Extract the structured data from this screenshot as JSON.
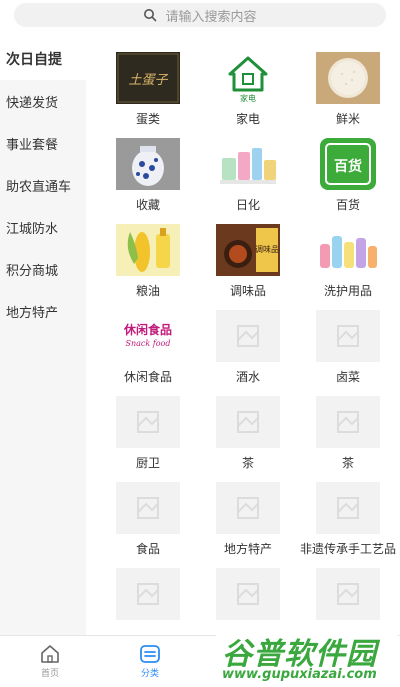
{
  "search": {
    "placeholder": "请输入搜索内容"
  },
  "sidebar": {
    "items": [
      {
        "label": "次日自提",
        "active": true
      },
      {
        "label": "快递发货"
      },
      {
        "label": "事业套餐"
      },
      {
        "label": "助农直通车"
      },
      {
        "label": "江城防水"
      },
      {
        "label": "积分商城"
      },
      {
        "label": "地方特产"
      }
    ]
  },
  "categories": [
    {
      "label": "蛋类",
      "icon": "egg-brand-image"
    },
    {
      "label": "家电",
      "icon": "appliance-house-icon"
    },
    {
      "label": "鲜米",
      "icon": "rice-image"
    },
    {
      "label": "收藏",
      "icon": "porcelain-vase-image"
    },
    {
      "label": "日化",
      "icon": "cosmetics-image"
    },
    {
      "label": "百货",
      "icon": "general-goods-logo"
    },
    {
      "label": "粮油",
      "icon": "corn-oil-image"
    },
    {
      "label": "调味品",
      "icon": "seasoning-image"
    },
    {
      "label": "洗护用品",
      "icon": "toiletries-image"
    },
    {
      "label": "休闲食品",
      "icon": "snack-food-logo"
    },
    {
      "label": "酒水",
      "icon": "placeholder-image"
    },
    {
      "label": "卤菜",
      "icon": "placeholder-image"
    },
    {
      "label": "厨卫",
      "icon": "placeholder-image"
    },
    {
      "label": "茶",
      "icon": "placeholder-image"
    },
    {
      "label": "茶",
      "icon": "placeholder-image"
    },
    {
      "label": "食品",
      "icon": "placeholder-image"
    },
    {
      "label": "地方特产",
      "icon": "placeholder-image"
    },
    {
      "label": "非遗传承手工艺品",
      "icon": "placeholder-image"
    }
  ],
  "logo_texts": {
    "egg": "土蛋子",
    "appliance": "家电",
    "general": "百货",
    "seasoning": "调味品",
    "snack": "休闲食品",
    "snack_en": "Snack food"
  },
  "tabbar": [
    {
      "label": "首页",
      "icon": "home-icon"
    },
    {
      "label": "分类",
      "icon": "category-icon",
      "active": true
    }
  ],
  "watermark": {
    "title": "谷普软件园",
    "url": "www.gupuxiazai.com"
  },
  "colors": {
    "accent": "#2c8cf4",
    "watermark": "#3aa83f",
    "sidebar_bg": "#f6f6f6",
    "search_bg": "#f1f1f1"
  }
}
